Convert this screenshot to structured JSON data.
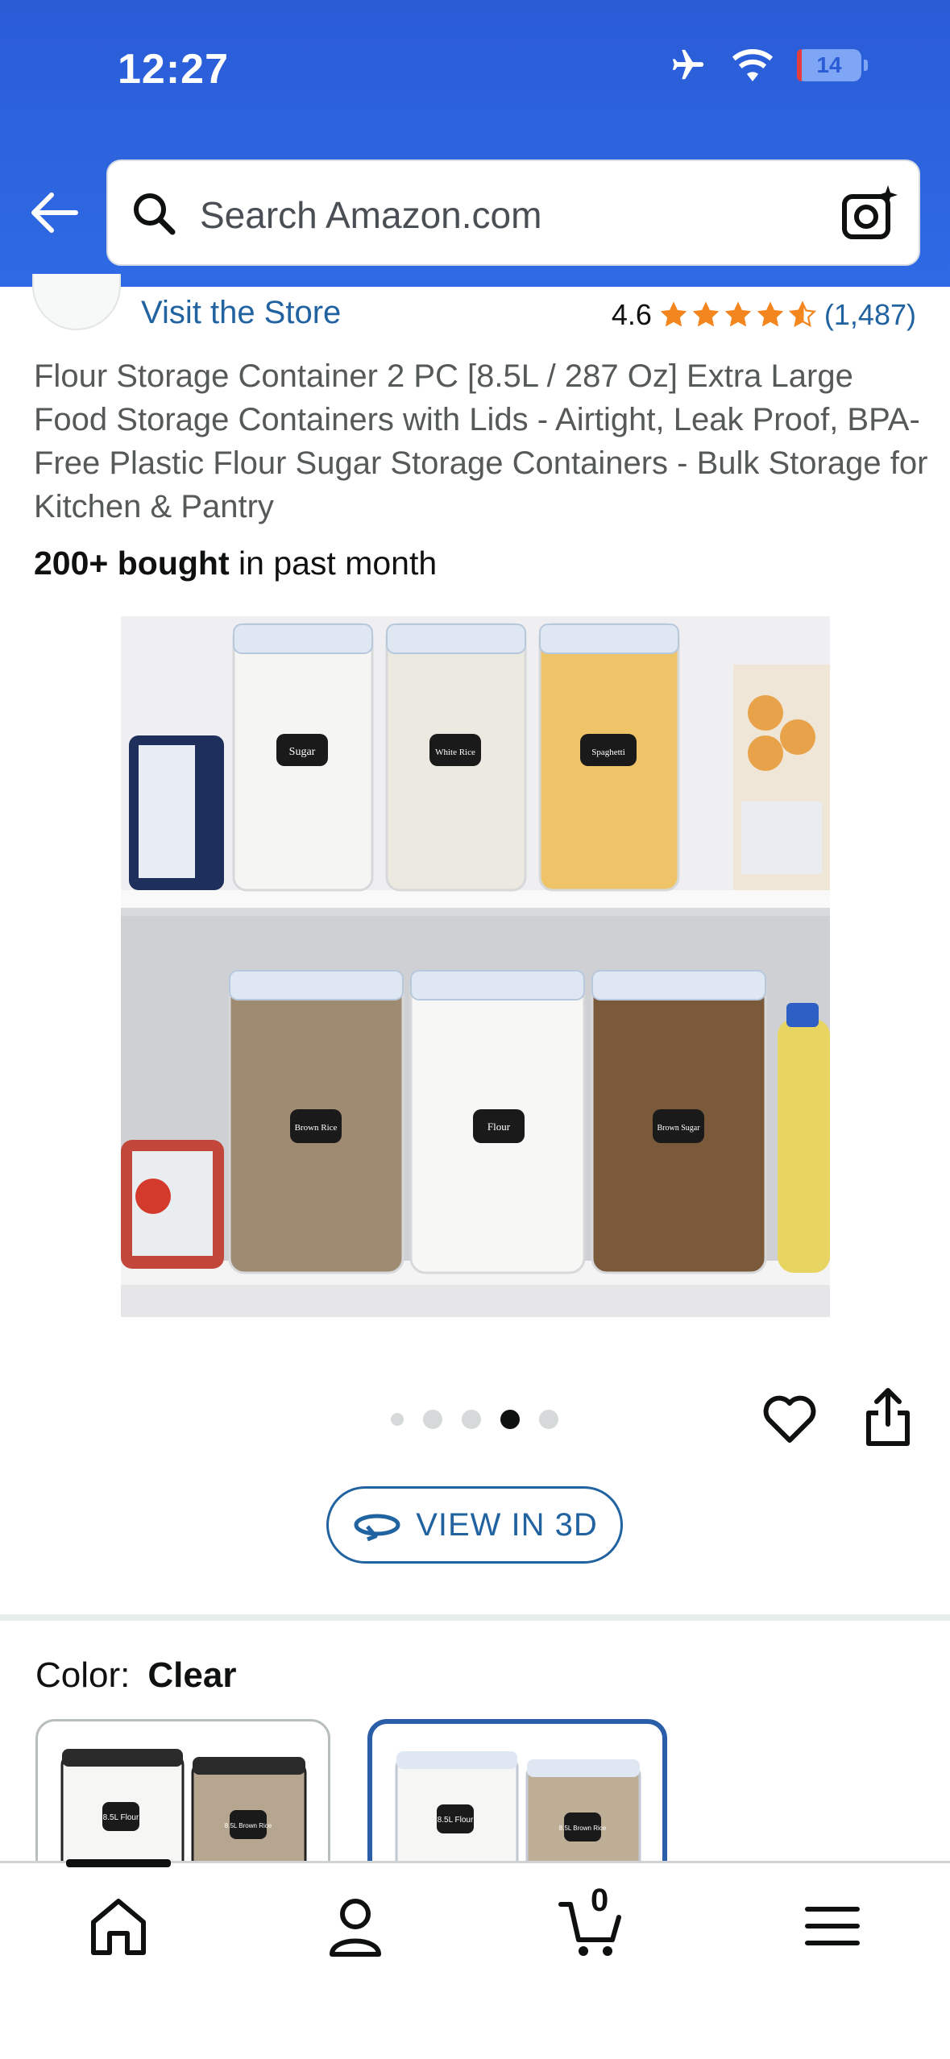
{
  "status_bar": {
    "time": "12:27",
    "battery_level": "14"
  },
  "search": {
    "placeholder": "Search Amazon.com"
  },
  "store": {
    "link_label": "Visit the Store"
  },
  "rating": {
    "value": "4.6",
    "stars": 4.5,
    "count": "(1,487)"
  },
  "product": {
    "title": "Flour Storage Container 2 PC [8.5L / 287 Oz] Extra Large Food Storage Containers with Lids - Airtight, Leak Proof, BPA-Free Plastic Flour Sugar Storage Containers - Bulk Storage for Kitchen & Pantry",
    "bought_bold": "200+ bought",
    "bought_rest": " in past month",
    "image": {
      "labels": [
        "Sugar",
        "White Rice",
        "Spaghetti",
        "Brown Rice",
        "Flour",
        "Brown Sugar"
      ],
      "page_index": 4,
      "page_count": 5
    }
  },
  "view3d": {
    "label": "VIEW IN 3D"
  },
  "color": {
    "label": "Color:",
    "value": "Clear"
  },
  "swatches": [
    {
      "labels": [
        "8.5L Flour",
        "8.5L Brown Rice"
      ],
      "selected": false
    },
    {
      "labels": [
        "8.5L Flour",
        "8.5L Brown Rice"
      ],
      "selected": true
    }
  ],
  "tabbar": {
    "cart_count": "0"
  },
  "colors": {
    "header_blue": "#2f6ae5",
    "link_blue": "#2162a1",
    "star_orange": "#f4861f"
  }
}
